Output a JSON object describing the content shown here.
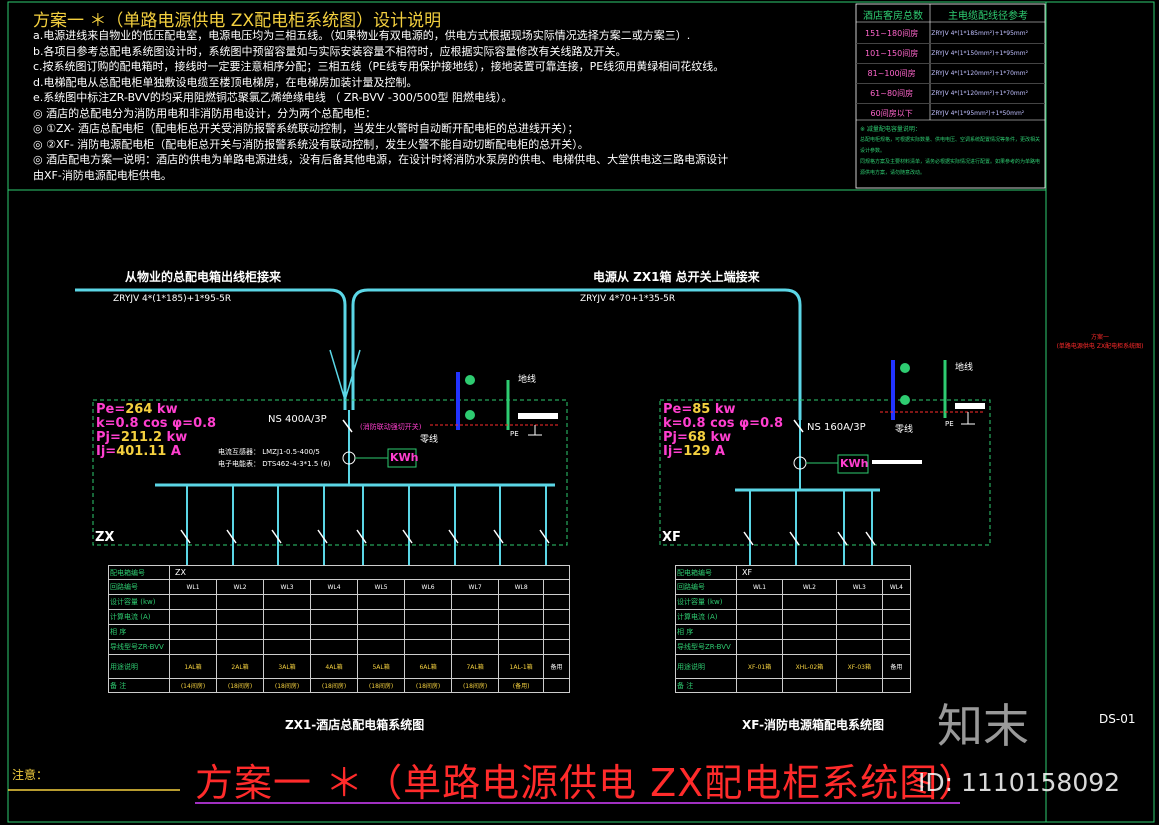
{
  "header": {
    "title": "方案一 ＊（单路电源供电 ZX配电柜系统图）设计说明",
    "notes": [
      "a.电源进线来自物业的低压配电室，电源电压均为三相五线。（如果物业有双电源的，供电方式根据现场实际情况选择方案二或方案三）.",
      "b.各项目参考总配电系统图设计时，系统图中预留容量如与实际安装容量不相符时，应根据实际容量修改有关线路及开关。",
      "c.按系统图订购的配电箱时，接线时一定要注意相序分配；三相五线（PE线专用保护接地线），接地装置可靠连接，PE线须用黄绿相间花纹线。",
      "d.电梯配电从总配电柜单独敷设电缆至楼顶电梯房，在电梯房加装计量及控制。",
      "e.系统图中标注ZR-BVV的均采用阻燃铜芯聚氯乙烯绝缘电线 （ ZR-BVV -300/500型 阻燃电线）。",
      "◎    酒店的总配电分为消防用电和非消防用电设计，分为两个总配电柜：",
      "◎         ①ZX- 酒店总配电柜（配电柜总开关受消防报警系统联动控制，当发生火警时自动断开配电柜的总进线开关）；",
      "◎         ②XF- 消防电源配电柜（配电柜总开关与消防报警系统没有联动控制，发生火警不能自动切断配电柜的总开关）。",
      "◎    酒店配电方案一说明：酒店的供电为单路电源进线，没有后备其他电源，在设计时将消防水泵房的供电、电梯供电、大堂供电这三路电源设计",
      "       由XF-消防电源配电柜供电。"
    ]
  },
  "ref_table": {
    "col1": "酒店客房总数",
    "col2": "主电缆配线径参考",
    "rows": [
      [
        "151~180间房",
        "ZRYJV 4*(1*185mm²)+1*95mm²"
      ],
      [
        "101~150间房",
        "ZRYJV 4*(1*150mm²)+1*95mm²"
      ],
      [
        "81~100间房",
        "ZRYJV 4*(1*120mm²)+1*70mm²"
      ],
      [
        "61~80间房",
        "ZRYJV 4*(1*120mm²)+1*70mm²"
      ],
      [
        "60间房以下",
        "ZRYJV 4*(1*95mm²)+1*50mm²"
      ]
    ],
    "note_lines": [
      "※    减量配电容量说明：",
      "      总配电柜规格，可根据实际数量、供电电压、空调系统配置情况等条件，更改相关设计参数。",
      "      同规格方案及主要材料清单，请务必根据实际情况进行配置。如果参考的为单路电源供电方案，请勿随意改动。"
    ]
  },
  "feeds": {
    "left_label": "从物业的总配电箱出线柜接来",
    "left_cable": "ZRYJV 4*(1*185)+1*95-5R",
    "right_label": "电源从 ZX1箱 总开关上端接来",
    "right_cable": "ZRYJV 4*70+1*35-5R"
  },
  "zx": {
    "code": "ZX",
    "pe_label": "Pe=",
    "pe": "264",
    "k_label": "k=0.8",
    "cos": "cos φ=0.8",
    "pj_label": "Pj=",
    "pj": "211.2",
    "ij_label": "Ij=",
    "ij": "401.11",
    "unit_kw": "kw",
    "unit_a": "A",
    "breaker": "NS 400A/3P",
    "linkage": "(消防联动强切开关)",
    "ct": "电流互感器： LMZJ1-0.5-400/5",
    "meter": "电子电能表： DTS462-4-3*1.5 (6)",
    "kwh": "KWh",
    "caption": "ZX1-酒店总配电箱系统图"
  },
  "xf": {
    "code": "XF",
    "pe_label": "Pe=",
    "pe": "85",
    "k_label": "k=0.8",
    "cos": "cos φ=0.8",
    "pj_label": "Pj=",
    "pj": "68",
    "ij_label": "Ij=",
    "ij": "129",
    "unit_kw": "kw",
    "unit_a": "A",
    "breaker": "NS 160A/3P",
    "kwh": "KWh",
    "caption": "XF-消防电源箱配电系统图"
  },
  "zx_table": {
    "labels": [
      "配电箱编号",
      "回路编号",
      "设计容量 (kw)",
      "计算电流 (A)",
      "相 序",
      "导线型号ZR-BVV",
      "用途说明",
      "备 注"
    ],
    "box": "ZX",
    "circuits": [
      "WL1",
      "WL2",
      "WL3",
      "WL4",
      "WL5",
      "WL6",
      "WL7",
      "WL8"
    ],
    "uses": [
      "1AL箱",
      "2AL箱",
      "3AL箱",
      "4AL箱",
      "5AL箱",
      "6AL箱",
      "7AL箱",
      "1AL-1箱"
    ],
    "remarks": [
      "(14间房)",
      "(18间房)",
      "(18间房)",
      "(18间房)",
      "(18间房)",
      "(18间房)",
      "(18间房)",
      "(备用)"
    ],
    "spare": "备用"
  },
  "xf_table": {
    "labels": [
      "配电箱编号",
      "回路编号",
      "设计容量 (kw)",
      "计算电流 (A)",
      "相 序",
      "导线型号ZR-BVV",
      "用途说明",
      "备 注"
    ],
    "box": "XF",
    "circuits": [
      "WL1",
      "WL2",
      "WL3",
      "WL4"
    ],
    "uses": [
      "XF-01箱",
      "XHL-02箱",
      "XF-03箱",
      "备用"
    ]
  },
  "ground": {
    "zero": "零线",
    "earth": "地线",
    "pe": "PE"
  },
  "big_title": "方案一 ＊（单路电源供电 ZX配电柜系统图）",
  "attention": "注意：",
  "sheet_code": "DS-01",
  "side_note": "方案一\n(单路电源供电 ZX配电柜系统图)",
  "watermark": "知末",
  "id_text": "ID: 1110158092",
  "colors": {
    "bus": "#5bd6e6",
    "frame": "#2ecc71",
    "title": "#ff2b2b",
    "accent": "#ff3fcf"
  }
}
